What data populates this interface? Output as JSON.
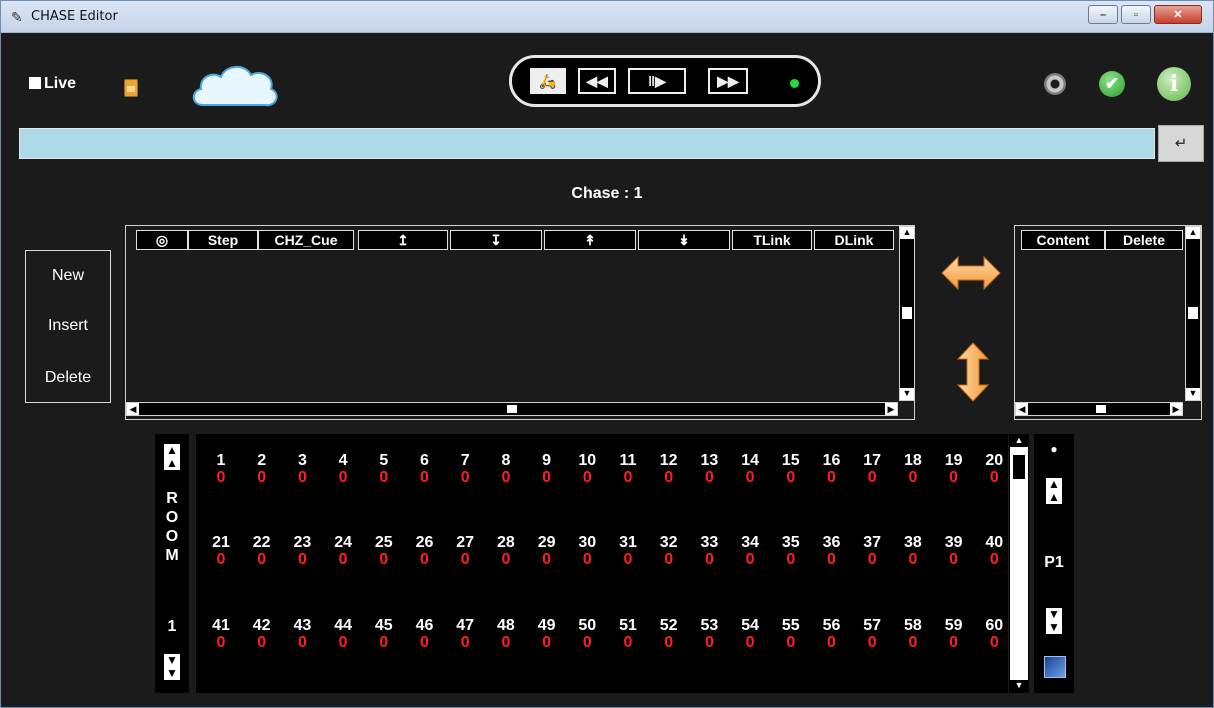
{
  "window": {
    "title": "CHASE Editor",
    "controls": {
      "minimize": "–",
      "maximize": "▫",
      "close": "✕"
    }
  },
  "toolbar": {
    "live_label": "Live",
    "live_checked": false,
    "icons": [
      "sim-card-icon",
      "cloud-icon",
      "gear-icon",
      "check-icon",
      "info-icon"
    ],
    "transport": {
      "scooter": "🛵",
      "rewind": "◀◀",
      "play_pause": "‖▶",
      "fast_forward": "▶▶",
      "status_color": "#19e03a"
    }
  },
  "command": {
    "value": "",
    "enter_label": "↵"
  },
  "chase": {
    "title": "Chase : 1"
  },
  "left_buttons": {
    "new": "New",
    "insert": "Insert",
    "delete": "Delete"
  },
  "steps_table": {
    "columns": [
      "◎",
      "Step",
      "CHZ_Cue",
      "↥",
      "↧",
      "↟",
      "↡",
      "TLink",
      "DLink"
    ],
    "rows": []
  },
  "content_table": {
    "columns": [
      "Content",
      "Delete"
    ],
    "rows": []
  },
  "room": {
    "letters": [
      "R",
      "O",
      "O",
      "M"
    ],
    "number": "1"
  },
  "page": {
    "label": "P1",
    "dot": "●"
  },
  "channels": [
    {
      "n": "1",
      "v": "0"
    },
    {
      "n": "2",
      "v": "0"
    },
    {
      "n": "3",
      "v": "0"
    },
    {
      "n": "4",
      "v": "0"
    },
    {
      "n": "5",
      "v": "0"
    },
    {
      "n": "6",
      "v": "0"
    },
    {
      "n": "7",
      "v": "0"
    },
    {
      "n": "8",
      "v": "0"
    },
    {
      "n": "9",
      "v": "0"
    },
    {
      "n": "10",
      "v": "0"
    },
    {
      "n": "11",
      "v": "0"
    },
    {
      "n": "12",
      "v": "0"
    },
    {
      "n": "13",
      "v": "0"
    },
    {
      "n": "14",
      "v": "0"
    },
    {
      "n": "15",
      "v": "0"
    },
    {
      "n": "16",
      "v": "0"
    },
    {
      "n": "17",
      "v": "0"
    },
    {
      "n": "18",
      "v": "0"
    },
    {
      "n": "19",
      "v": "0"
    },
    {
      "n": "20",
      "v": "0"
    },
    {
      "n": "21",
      "v": "0"
    },
    {
      "n": "22",
      "v": "0"
    },
    {
      "n": "23",
      "v": "0"
    },
    {
      "n": "24",
      "v": "0"
    },
    {
      "n": "25",
      "v": "0"
    },
    {
      "n": "26",
      "v": "0"
    },
    {
      "n": "27",
      "v": "0"
    },
    {
      "n": "28",
      "v": "0"
    },
    {
      "n": "29",
      "v": "0"
    },
    {
      "n": "30",
      "v": "0"
    },
    {
      "n": "31",
      "v": "0"
    },
    {
      "n": "32",
      "v": "0"
    },
    {
      "n": "33",
      "v": "0"
    },
    {
      "n": "34",
      "v": "0"
    },
    {
      "n": "35",
      "v": "0"
    },
    {
      "n": "36",
      "v": "0"
    },
    {
      "n": "37",
      "v": "0"
    },
    {
      "n": "38",
      "v": "0"
    },
    {
      "n": "39",
      "v": "0"
    },
    {
      "n": "40",
      "v": "0"
    },
    {
      "n": "41",
      "v": "0"
    },
    {
      "n": "42",
      "v": "0"
    },
    {
      "n": "43",
      "v": "0"
    },
    {
      "n": "44",
      "v": "0"
    },
    {
      "n": "45",
      "v": "0"
    },
    {
      "n": "46",
      "v": "0"
    },
    {
      "n": "47",
      "v": "0"
    },
    {
      "n": "48",
      "v": "0"
    },
    {
      "n": "49",
      "v": "0"
    },
    {
      "n": "50",
      "v": "0"
    },
    {
      "n": "51",
      "v": "0"
    },
    {
      "n": "52",
      "v": "0"
    },
    {
      "n": "53",
      "v": "0"
    },
    {
      "n": "54",
      "v": "0"
    },
    {
      "n": "55",
      "v": "0"
    },
    {
      "n": "56",
      "v": "0"
    },
    {
      "n": "57",
      "v": "0"
    },
    {
      "n": "58",
      "v": "0"
    },
    {
      "n": "59",
      "v": "0"
    },
    {
      "n": "60",
      "v": "0"
    }
  ],
  "colors": {
    "background": "#1b1b1b",
    "command_bar": "#add8e6",
    "channel_value": "#ff1e1e",
    "arrow_orange": "#f7a347"
  }
}
